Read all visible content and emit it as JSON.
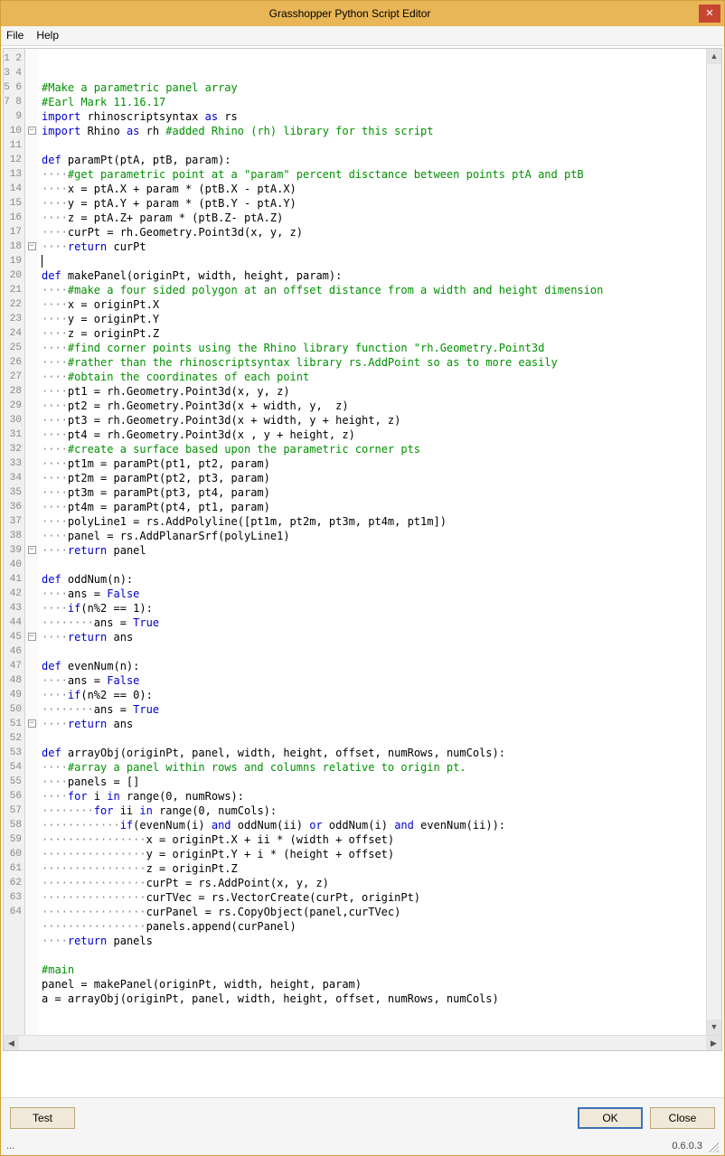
{
  "window": {
    "title": "Grasshopper Python Script Editor",
    "close_label": "✕"
  },
  "menu": {
    "file": "File",
    "help": "Help"
  },
  "buttons": {
    "test": "Test",
    "ok": "OK",
    "close": "Close"
  },
  "status": {
    "left": "...",
    "version": "0.6.0.3"
  },
  "scroll": {
    "up": "▲",
    "down": "▼",
    "left": "◀",
    "right": "▶"
  },
  "fold_glyph": "−",
  "line_count": 64,
  "fold_lines": [
    6,
    14,
    35,
    41,
    47
  ],
  "code": {
    "1": [
      [
        "c",
        "#Make a parametric panel array"
      ]
    ],
    "2": [
      [
        "c",
        "#Earl Mark 11.16.17"
      ]
    ],
    "3": [
      [
        "k",
        "import"
      ],
      [
        "n",
        " rhinoscriptsyntax "
      ],
      [
        "k",
        "as"
      ],
      [
        "n",
        " rs"
      ]
    ],
    "4": [
      [
        "k",
        "import"
      ],
      [
        "n",
        " Rhino "
      ],
      [
        "k",
        "as"
      ],
      [
        "n",
        " rh "
      ],
      [
        "c",
        "#added Rhino (rh) library for this script"
      ]
    ],
    "5": [],
    "6": [
      [
        "k",
        "def"
      ],
      [
        "n",
        " paramPt(ptA, ptB, param):"
      ]
    ],
    "7": [
      [
        "d",
        "····"
      ],
      [
        "c",
        "#get parametric point at a \"param\" percent disctance between points ptA and ptB"
      ]
    ],
    "8": [
      [
        "d",
        "····"
      ],
      [
        "n",
        "x = ptA.X + param * (ptB.X - ptA.X)"
      ]
    ],
    "9": [
      [
        "d",
        "····"
      ],
      [
        "n",
        "y = ptA.Y + param * (ptB.Y - ptA.Y)"
      ]
    ],
    "10": [
      [
        "d",
        "····"
      ],
      [
        "n",
        "z = ptA.Z+ param * (ptB.Z- ptA.Z)"
      ]
    ],
    "11": [
      [
        "d",
        "····"
      ],
      [
        "n",
        "curPt = rh.Geometry.Point3d(x, y, z)"
      ]
    ],
    "12": [
      [
        "d",
        "····"
      ],
      [
        "k",
        "return"
      ],
      [
        "n",
        " curPt"
      ]
    ],
    "13": [],
    "14": [
      [
        "k",
        "def"
      ],
      [
        "n",
        " makePanel(originPt, width, height, param):"
      ]
    ],
    "15": [
      [
        "d",
        "····"
      ],
      [
        "c",
        "#make a four sided polygon at an offset distance from a width and height dimension"
      ]
    ],
    "16": [
      [
        "d",
        "····"
      ],
      [
        "n",
        "x = originPt.X"
      ]
    ],
    "17": [
      [
        "d",
        "····"
      ],
      [
        "n",
        "y = originPt.Y"
      ]
    ],
    "18": [
      [
        "d",
        "····"
      ],
      [
        "n",
        "z = originPt.Z"
      ]
    ],
    "19": [
      [
        "d",
        "····"
      ],
      [
        "c",
        "#find corner points using the Rhino library function \"rh.Geometry.Point3d"
      ]
    ],
    "20": [
      [
        "d",
        "····"
      ],
      [
        "c",
        "#rather than the rhinoscriptsyntax library rs.AddPoint so as to more easily"
      ]
    ],
    "21": [
      [
        "d",
        "····"
      ],
      [
        "c",
        "#obtain the coordinates of each point"
      ]
    ],
    "22": [
      [
        "d",
        "····"
      ],
      [
        "n",
        "pt1 = rh.Geometry.Point3d(x, y, z)"
      ]
    ],
    "23": [
      [
        "d",
        "····"
      ],
      [
        "n",
        "pt2 = rh.Geometry.Point3d(x + width, y,  z)"
      ]
    ],
    "24": [
      [
        "d",
        "····"
      ],
      [
        "n",
        "pt3 = rh.Geometry.Point3d(x + width, y + height, z)"
      ]
    ],
    "25": [
      [
        "d",
        "····"
      ],
      [
        "n",
        "pt4 = rh.Geometry.Point3d(x , y + height, z)"
      ]
    ],
    "26": [
      [
        "d",
        "····"
      ],
      [
        "c",
        "#create a surface based upon the parametric corner pts"
      ]
    ],
    "27": [
      [
        "d",
        "····"
      ],
      [
        "n",
        "pt1m = paramPt(pt1, pt2, param)"
      ]
    ],
    "28": [
      [
        "d",
        "····"
      ],
      [
        "n",
        "pt2m = paramPt(pt2, pt3, param)"
      ]
    ],
    "29": [
      [
        "d",
        "····"
      ],
      [
        "n",
        "pt3m = paramPt(pt3, pt4, param)"
      ]
    ],
    "30": [
      [
        "d",
        "····"
      ],
      [
        "n",
        "pt4m = paramPt(pt4, pt1, param)"
      ]
    ],
    "31": [
      [
        "d",
        "····"
      ],
      [
        "n",
        "polyLine1 = rs.AddPolyline([pt1m, pt2m, pt3m, pt4m, pt1m])"
      ]
    ],
    "32": [
      [
        "d",
        "····"
      ],
      [
        "n",
        "panel = rs.AddPlanarSrf(polyLine1)"
      ]
    ],
    "33": [
      [
        "d",
        "····"
      ],
      [
        "k",
        "return"
      ],
      [
        "n",
        " panel"
      ]
    ],
    "34": [],
    "35": [
      [
        "k",
        "def"
      ],
      [
        "n",
        " oddNum(n):"
      ]
    ],
    "36": [
      [
        "d",
        "····"
      ],
      [
        "n",
        "ans = "
      ],
      [
        "k",
        "False"
      ]
    ],
    "37": [
      [
        "d",
        "····"
      ],
      [
        "k",
        "if"
      ],
      [
        "n",
        "(n%2 == 1):"
      ]
    ],
    "38": [
      [
        "d",
        "········"
      ],
      [
        "n",
        "ans = "
      ],
      [
        "k",
        "True"
      ]
    ],
    "39": [
      [
        "d",
        "····"
      ],
      [
        "k",
        "return"
      ],
      [
        "n",
        " ans"
      ]
    ],
    "40": [],
    "41": [
      [
        "k",
        "def"
      ],
      [
        "n",
        " evenNum(n):"
      ]
    ],
    "42": [
      [
        "d",
        "····"
      ],
      [
        "n",
        "ans = "
      ],
      [
        "k",
        "False"
      ]
    ],
    "43": [
      [
        "d",
        "····"
      ],
      [
        "k",
        "if"
      ],
      [
        "n",
        "(n%2 == 0):"
      ]
    ],
    "44": [
      [
        "d",
        "········"
      ],
      [
        "n",
        "ans = "
      ],
      [
        "k",
        "True"
      ]
    ],
    "45": [
      [
        "d",
        "····"
      ],
      [
        "k",
        "return"
      ],
      [
        "n",
        " ans"
      ]
    ],
    "46": [],
    "47": [
      [
        "k",
        "def"
      ],
      [
        "n",
        " arrayObj(originPt, panel, width, height, offset, numRows, numCols):"
      ]
    ],
    "48": [
      [
        "d",
        "····"
      ],
      [
        "c",
        "#array a panel within rows and columns relative to origin pt."
      ]
    ],
    "49": [
      [
        "d",
        "····"
      ],
      [
        "n",
        "panels = []"
      ]
    ],
    "50": [
      [
        "d",
        "····"
      ],
      [
        "k",
        "for"
      ],
      [
        "n",
        " i "
      ],
      [
        "k",
        "in"
      ],
      [
        "n",
        " range(0, numRows):"
      ]
    ],
    "51": [
      [
        "d",
        "········"
      ],
      [
        "k",
        "for"
      ],
      [
        "n",
        " ii "
      ],
      [
        "k",
        "in"
      ],
      [
        "n",
        " range(0, numCols):"
      ]
    ],
    "52": [
      [
        "d",
        "············"
      ],
      [
        "k",
        "if"
      ],
      [
        "n",
        "(evenNum(i) "
      ],
      [
        "k",
        "and"
      ],
      [
        "n",
        " oddNum(ii) "
      ],
      [
        "k",
        "or"
      ],
      [
        "n",
        " oddNum(i) "
      ],
      [
        "k",
        "and"
      ],
      [
        "n",
        " evenNum(ii)):"
      ]
    ],
    "53": [
      [
        "d",
        "················"
      ],
      [
        "n",
        "x = originPt.X + ii * (width + offset)"
      ]
    ],
    "54": [
      [
        "d",
        "················"
      ],
      [
        "n",
        "y = originPt.Y + i * (height + offset)"
      ]
    ],
    "55": [
      [
        "d",
        "················"
      ],
      [
        "n",
        "z = originPt.Z"
      ]
    ],
    "56": [
      [
        "d",
        "················"
      ],
      [
        "n",
        "curPt = rs.AddPoint(x, y, z)"
      ]
    ],
    "57": [
      [
        "d",
        "················"
      ],
      [
        "n",
        "curTVec = rs.VectorCreate(curPt, originPt)"
      ]
    ],
    "58": [
      [
        "d",
        "················"
      ],
      [
        "n",
        "curPanel = rs.CopyObject(panel,curTVec)"
      ]
    ],
    "59": [
      [
        "d",
        "················"
      ],
      [
        "n",
        "panels.append(curPanel)"
      ]
    ],
    "60": [
      [
        "d",
        "····"
      ],
      [
        "k",
        "return"
      ],
      [
        "n",
        " panels"
      ]
    ],
    "61": [],
    "62": [
      [
        "c",
        "#main"
      ]
    ],
    "63": [
      [
        "n",
        "panel = makePanel(originPt, width, height, param)"
      ]
    ],
    "64": [
      [
        "n",
        "a = arrayObj(originPt, panel, width, height, offset, numRows, numCols)"
      ]
    ]
  }
}
